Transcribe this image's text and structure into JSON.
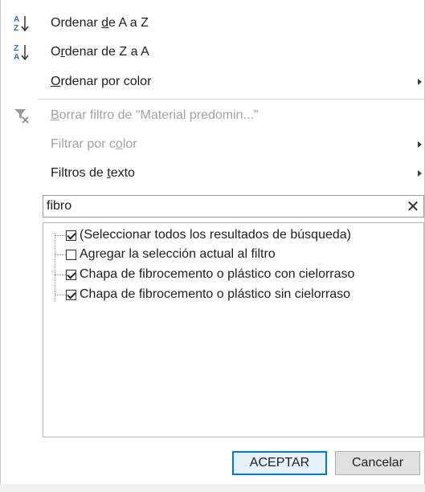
{
  "menu": {
    "sort_az": {
      "prefix": "Ordenar ",
      "accel": "d",
      "suffix": "e A a Z",
      "icon": "sort-az-icon"
    },
    "sort_za": {
      "prefix": "O",
      "accel": "r",
      "suffix": "denar de Z a A",
      "icon": "sort-za-icon"
    },
    "sort_color": {
      "prefix": "",
      "accel": "O",
      "suffix": "rdenar por color"
    },
    "clear_filter": {
      "prefix": "",
      "accel": "B",
      "suffix": "orrar filtro de \"Material predomin...\"",
      "icon": "clear-filter-icon"
    },
    "filter_color": {
      "prefix": "Filtrar por c",
      "accel": "o",
      "suffix": "lor"
    },
    "text_filters": {
      "prefix": "Filtros de ",
      "accel": "t",
      "suffix": "exto"
    }
  },
  "search": {
    "value": "fibro",
    "clear_glyph": "✕"
  },
  "list": {
    "items": [
      {
        "label": "(Seleccionar todos los resultados de búsqueda)",
        "checked": true
      },
      {
        "label": "Agregar la selección actual al filtro",
        "checked": false
      },
      {
        "label": "Chapa de fibrocemento o plástico con cielorraso",
        "checked": true
      },
      {
        "label": "Chapa de fibrocemento o plástico sin cielorraso",
        "checked": true
      }
    ]
  },
  "buttons": {
    "ok": "ACEPTAR",
    "cancel": "Cancelar"
  },
  "colors": {
    "accent": "#0078d7",
    "disabled_text": "#a2a2a2",
    "sort_icon_blue": "#2b6cc4"
  }
}
